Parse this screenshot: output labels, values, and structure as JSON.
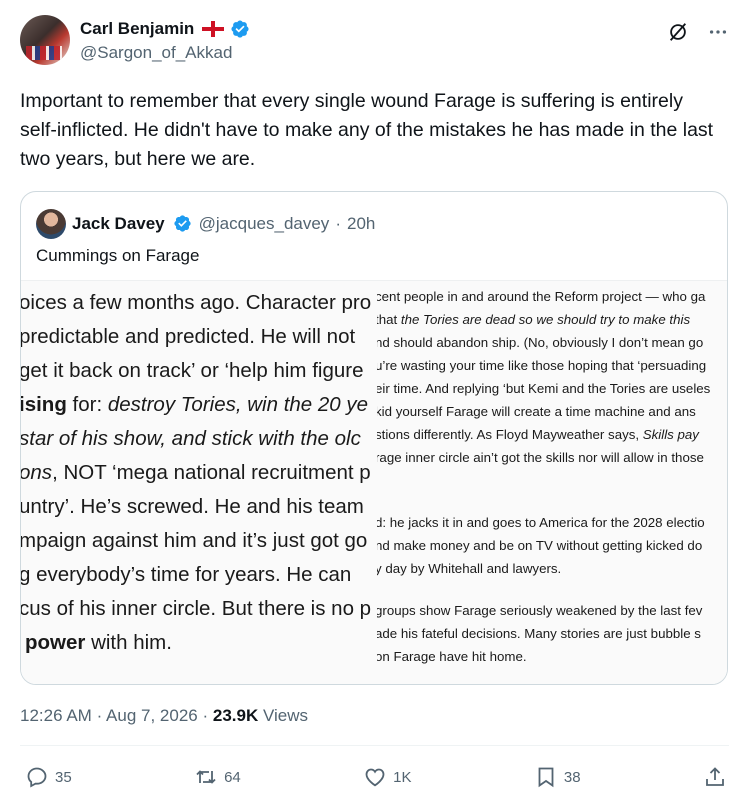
{
  "author": {
    "display_name": "Carl Benjamin",
    "handle": "@Sargon_of_Akkad",
    "flag_icon": "england-flag-icon",
    "verified_color": "#1d9bf0"
  },
  "tweet": {
    "text": "Important to remember that every single wound Farage is suffering is entirely self-inflicted. He didn't have to make any of the mistakes he has made in the last two years, but here we are."
  },
  "quote": {
    "display_name": "Jack Davey",
    "handle": "@jacques_davey",
    "separator": "·",
    "time": "20h",
    "text": "Cummings on Farage",
    "image_left": [
      "oices a few months ago. Character pro",
      "predictable and predicted. He will not",
      "get it back on track’ or ‘help him figure",
      "ising for: destroy Tories, win the 20 ye",
      "star of his show, and stick with the olc",
      "ons, NOT ‘mega national recruitment p",
      "untry’. He’s screwed. He and his team",
      "mpaign against him and it’s just got go",
      "g everybody’s time for years. He can",
      "cus of his inner circle. But there is no p",
      "power with him."
    ],
    "image_right": [
      "cent people in and around the Reform project — who ga",
      "that the Tories are dead so we should try to make this",
      "nd should abandon ship. (No, obviously I don’t mean go",
      "u’re wasting your time like those hoping that ‘persuading",
      "eir time. And replying ‘but Kemi and the Tories are useles",
      "kid yourself Farage will create a time machine and ans",
      "stions differently. As Floyd Mayweather says, Skills pay",
      "rage inner circle ain’t got the skills nor will allow in those",
      "d: he jacks it in and goes to America for the 2028 electio",
      "nd make money and be on TV without getting kicked do",
      "y day by Whitehall and lawyers.",
      "groups show Farage seriously weakened by the last fev",
      "ade his fateful decisions. Many stories are just bubble s",
      "on Farage have hit home."
    ]
  },
  "meta": {
    "time": "12:26 AM",
    "separator": "·",
    "date": "Aug 7, 2026",
    "separator2": "·",
    "views_count": "23.9K",
    "views_label": "Views"
  },
  "actions": {
    "replies": "35",
    "reposts": "64",
    "likes": "1K",
    "bookmarks": "38"
  }
}
